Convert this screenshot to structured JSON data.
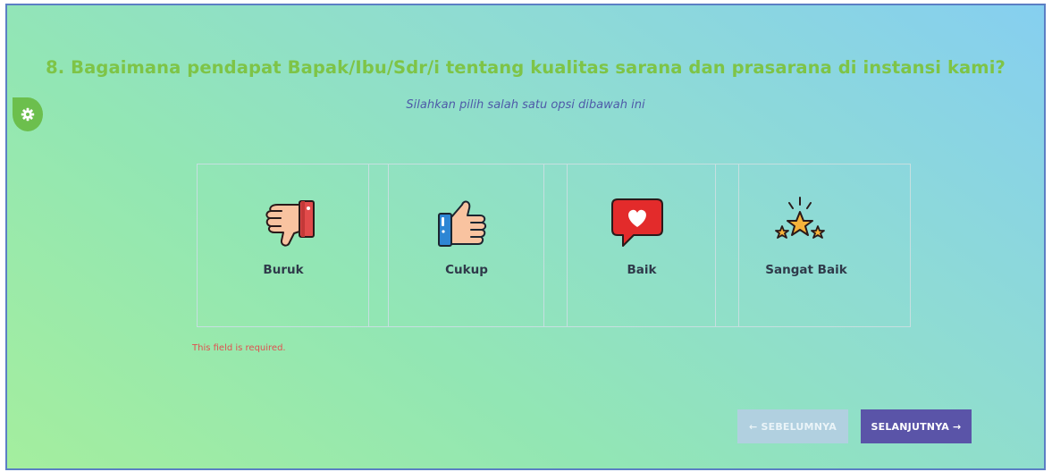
{
  "question": {
    "title": "8. Bagaimana pendapat Bapak/Ibu/Sdr/i tentang kualitas sarana dan prasarana di instansi kami?",
    "subtitle": "Silahkan pilih salah satu opsi dibawah ini"
  },
  "options": [
    {
      "label": "Buruk",
      "icon": "thumbs-down-icon"
    },
    {
      "label": "Cukup",
      "icon": "thumbs-up-icon"
    },
    {
      "label": "Baik",
      "icon": "heart-message-icon"
    },
    {
      "label": "Sangat Baik",
      "icon": "stars-icon"
    }
  ],
  "validation": {
    "error": "This field is required."
  },
  "nav": {
    "prev_label": "← SEBELUMNYA",
    "next_label": "SELANJUTNYA →"
  },
  "colors": {
    "title": "#7ec447",
    "subtitle": "#4e5aa8",
    "error": "#e05050",
    "next_button": "#5a54a8",
    "prev_button": "#b1d0e0"
  }
}
